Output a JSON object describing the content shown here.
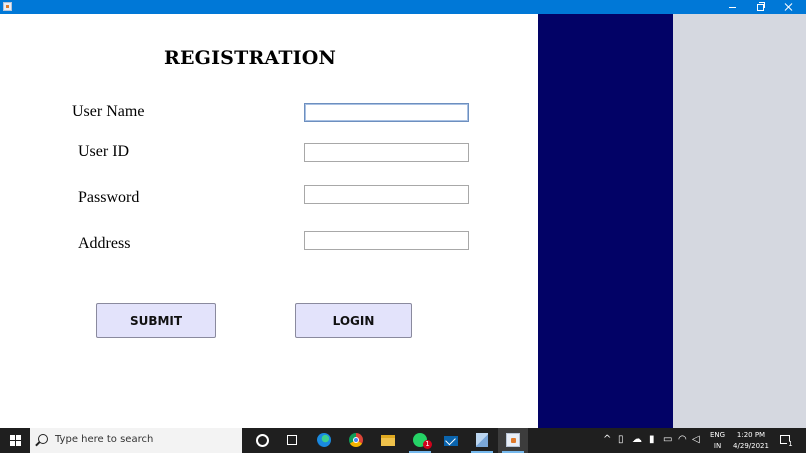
{
  "window": {
    "minimize_glyph": "—",
    "maximize_glyph": "❐",
    "close_glyph": "✕"
  },
  "form": {
    "title": "REGISTRATION",
    "fields": [
      {
        "label": "User Name",
        "value": ""
      },
      {
        "label": "User ID",
        "value": ""
      },
      {
        "label": "Password",
        "value": ""
      },
      {
        "label": "Address",
        "value": ""
      }
    ],
    "buttons": {
      "submit": "SUBMIT",
      "login": "LOGIN"
    }
  },
  "colors": {
    "form_bg": "#ffffff",
    "navy_panel": "#020266",
    "grey_panel": "#d5d8e0",
    "button_bg": "#e3e3fb",
    "titlebar": "#0078d7",
    "taskbar": "#1f1f1f"
  },
  "taskbar": {
    "search_placeholder": "Type here to search",
    "pinned_icons": [
      "cortana-icon",
      "task-view-icon",
      "edge-icon",
      "chrome-icon",
      "file-explorer-icon",
      "whatsapp-icon",
      "mail-icon",
      "3d-box-icon",
      "java-app-icon"
    ],
    "whatsapp_badge": "1",
    "tray": {
      "chevron": "^",
      "lang_top": "ENG",
      "lang_bottom": "IN",
      "time": "1:20 PM",
      "date": "4/29/2021",
      "notification_badge": "1"
    }
  }
}
